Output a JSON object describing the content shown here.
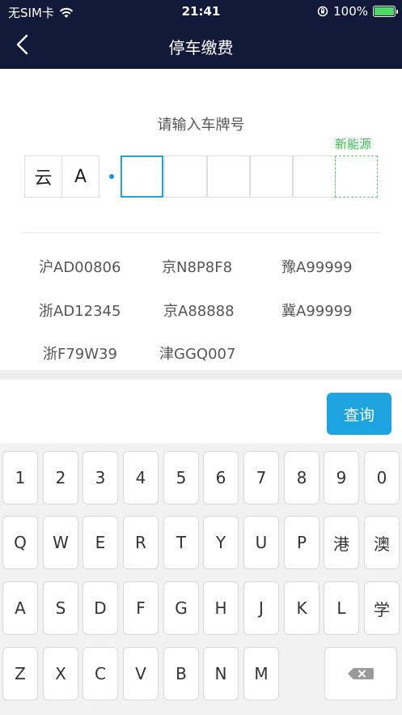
{
  "status_bar": {
    "carrier": "无SIM卡",
    "time": "21:41",
    "battery": "100%",
    "battery_level": 1.0
  },
  "nav": {
    "title": "停车缴费"
  },
  "plate_input": {
    "prompt": "请输入车牌号",
    "province": "云",
    "letter": "A",
    "new_energy_label": "新能源"
  },
  "history": [
    "沪AD00806",
    "京N8P8F8",
    "豫A99999",
    "浙AD12345",
    "京A88888",
    "冀A99999",
    "浙F79W39",
    "津GGQ007"
  ],
  "query_button": "查询",
  "keyboard": {
    "row1": [
      "1",
      "2",
      "3",
      "4",
      "5",
      "6",
      "7",
      "8",
      "9",
      "0"
    ],
    "row2": [
      "Q",
      "W",
      "E",
      "R",
      "T",
      "Y",
      "U",
      "P",
      "港",
      "澳"
    ],
    "row3": [
      "A",
      "S",
      "D",
      "F",
      "G",
      "H",
      "J",
      "K",
      "L",
      "学"
    ],
    "row4": [
      "Z",
      "X",
      "C",
      "V",
      "B",
      "N",
      "M"
    ]
  },
  "colors": {
    "header_bg": "#121a3a",
    "accent": "#1da3e0",
    "new_energy": "#35c24c"
  }
}
